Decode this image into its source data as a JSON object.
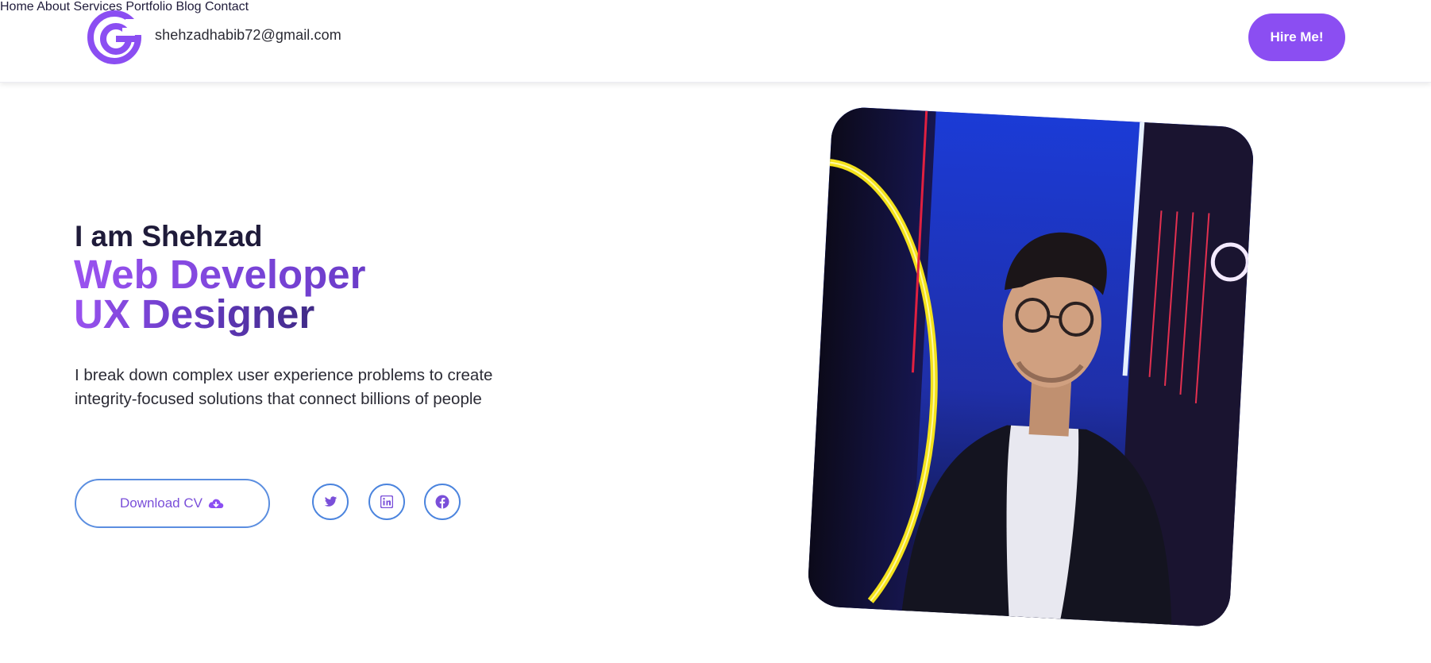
{
  "header": {
    "email": "shehzadhabib72@gmail.com",
    "nav": [
      "Home",
      "About",
      "Services",
      "Portfolio",
      "Blog",
      "Contact"
    ],
    "cta_label": "Hire Me!"
  },
  "hero": {
    "intro": "I am Shehzad",
    "roles": [
      "Web Developer",
      "UX Designer"
    ],
    "description": "I break down complex user experience problems to create integrity-focused solutions that connect billions of people",
    "download_label": "Download CV",
    "socials": [
      "twitter-icon",
      "linkedin-icon",
      "facebook-icon"
    ]
  },
  "colors": {
    "accent": "#8b4ef2",
    "outline": "#4b84de",
    "dark_text": "#1f1b3a"
  }
}
